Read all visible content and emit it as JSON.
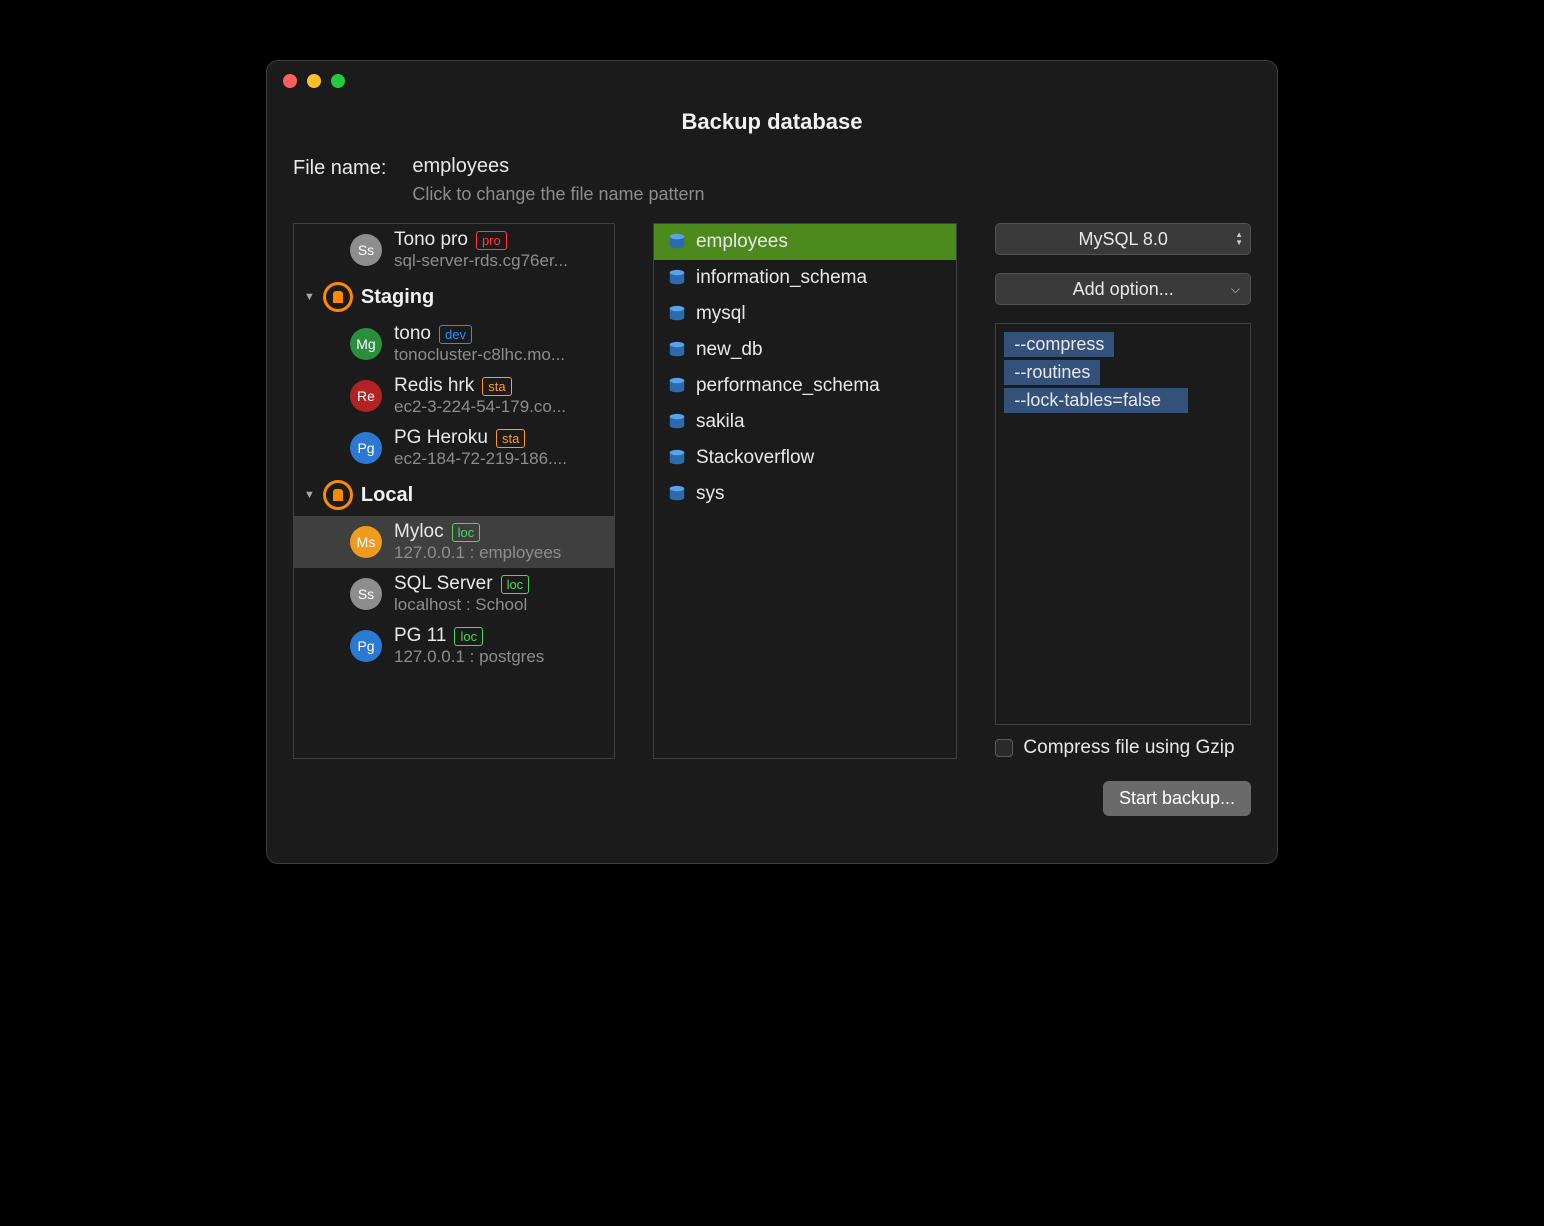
{
  "title": "Backup database",
  "filename": {
    "label": "File name:",
    "value": "employees",
    "hint": "Click to change the file name pattern"
  },
  "connections": {
    "orphan": {
      "name": "Tono pro",
      "tag": "pro",
      "sub": "sql-server-rds.cg76er...",
      "badge": "Ss",
      "color": "#8d8d8d"
    },
    "groups": [
      {
        "label": "Staging",
        "items": [
          {
            "name": "tono",
            "tag": "dev",
            "sub": "tonocluster-c8lhc.mo...",
            "badge": "Mg",
            "color": "#2a8f3d"
          },
          {
            "name": "Redis hrk",
            "tag": "sta",
            "sub": "ec2-3-224-54-179.co...",
            "badge": "Re",
            "color": "#b22222"
          },
          {
            "name": "PG Heroku",
            "tag": "sta",
            "sub": "ec2-184-72-219-186....",
            "badge": "Pg",
            "color": "#2a7ad4"
          }
        ]
      },
      {
        "label": "Local",
        "items": [
          {
            "name": "Myloc",
            "tag": "loc",
            "sub": "127.0.0.1 : employees",
            "badge": "Ms",
            "color": "#f09a1e",
            "selected": true
          },
          {
            "name": "SQL Server",
            "tag": "loc",
            "sub": "localhost : School",
            "badge": "Ss",
            "color": "#8d8d8d"
          },
          {
            "name": "PG 11",
            "tag": "loc",
            "sub": "127.0.0.1 : postgres",
            "badge": "Pg",
            "color": "#2a7ad4"
          }
        ]
      }
    ]
  },
  "databases": [
    {
      "name": "employees",
      "selected": true
    },
    {
      "name": "information_schema"
    },
    {
      "name": "mysql"
    },
    {
      "name": "new_db"
    },
    {
      "name": "performance_schema"
    },
    {
      "name": "sakila"
    },
    {
      "name": "Stackoverflow"
    },
    {
      "name": "sys"
    }
  ],
  "version_select": "MySQL 8.0",
  "add_option_label": "Add option...",
  "options": [
    "--compress",
    "--routines",
    "--lock-tables=false"
  ],
  "gzip_label": "Compress file using Gzip",
  "start_label": "Start backup..."
}
